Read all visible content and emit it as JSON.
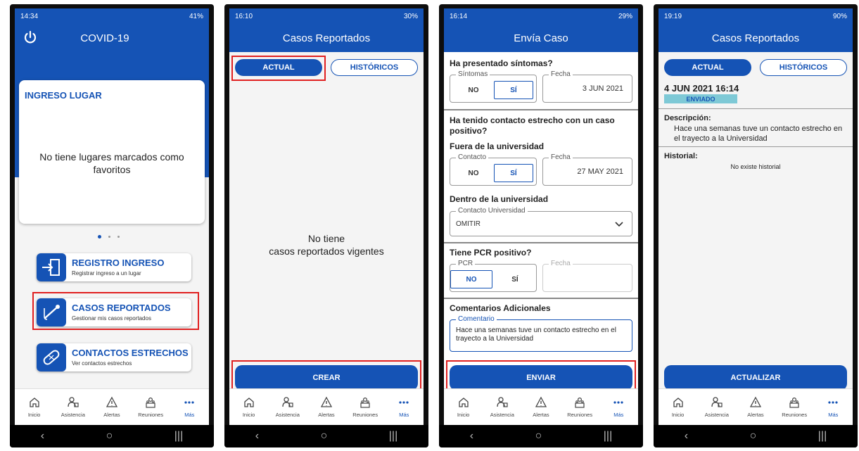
{
  "nav": [
    "Inicio",
    "Asistencia",
    "Alertas",
    "Reuniones",
    "Más"
  ],
  "sys_buttons": [
    "‹",
    "○",
    "|||"
  ],
  "p1": {
    "time": "14:34",
    "battery": "41%",
    "title": "COVID-19",
    "card_title": "INGRESO LUGAR",
    "card_msg": "No tiene lugares marcados como favoritos",
    "menu": [
      {
        "title": "REGISTRO INGRESO",
        "sub": "Registrar ingreso a un lugar"
      },
      {
        "title": "CASOS REPORTADOS",
        "sub": "Gestionar mis casos reportados"
      },
      {
        "title": "CONTACTOS ESTRECHOS",
        "sub": "Ver contactos estrechos"
      }
    ]
  },
  "p2": {
    "time": "16:10",
    "battery": "30%",
    "title": "Casos Reportados",
    "tab_actual": "ACTUAL",
    "tab_hist": "HISTÓRICOS",
    "empty_msg": "No tiene\ncasos reportados vigentes",
    "btn": "CREAR"
  },
  "p3": {
    "time": "16:14",
    "battery": "29%",
    "title": "Envía Caso",
    "q1": "Ha presentado síntomas?",
    "sintomas_label": "Síntomas",
    "no": "NO",
    "si": "SÍ",
    "fecha_label": "Fecha",
    "fecha1": "3 JUN 2021",
    "q2": "Ha tenido contacto estrecho con un caso positivo?",
    "fuera": "Fuera de la universidad",
    "contacto_label": "Contacto",
    "fecha2": "27 MAY 2021",
    "dentro": "Dentro de la universidad",
    "contacto_univ_label": "Contacto Universidad",
    "contacto_univ_val": "OMITIR",
    "q3": "Tiene PCR positivo?",
    "pcr_label": "PCR",
    "q4": "Comentarios Adicionales",
    "comentario_label": "Comentario",
    "comentario_val": "Hace una semanas tuve un contacto estrecho en el trayecto a la Universidad",
    "btn": "ENVIAR"
  },
  "p4": {
    "time": "19:19",
    "battery": "90%",
    "title": "Casos Reportados",
    "tab_actual": "ACTUAL",
    "tab_hist": "HISTÓRICOS",
    "date": "4 JUN 2021 16:14",
    "badge": "ENVIADO",
    "desc_label": "Descripción:",
    "desc_val": "Hace una semanas tuve un contacto estrecho en el trayecto a la Universidad",
    "hist_label": "Historial:",
    "hist_val": "No existe historial",
    "btn": "ACTUALIZAR"
  },
  "colors": {
    "primary": "#1553b5",
    "highlight": "#e02020",
    "badge": "#7ec9d6"
  }
}
